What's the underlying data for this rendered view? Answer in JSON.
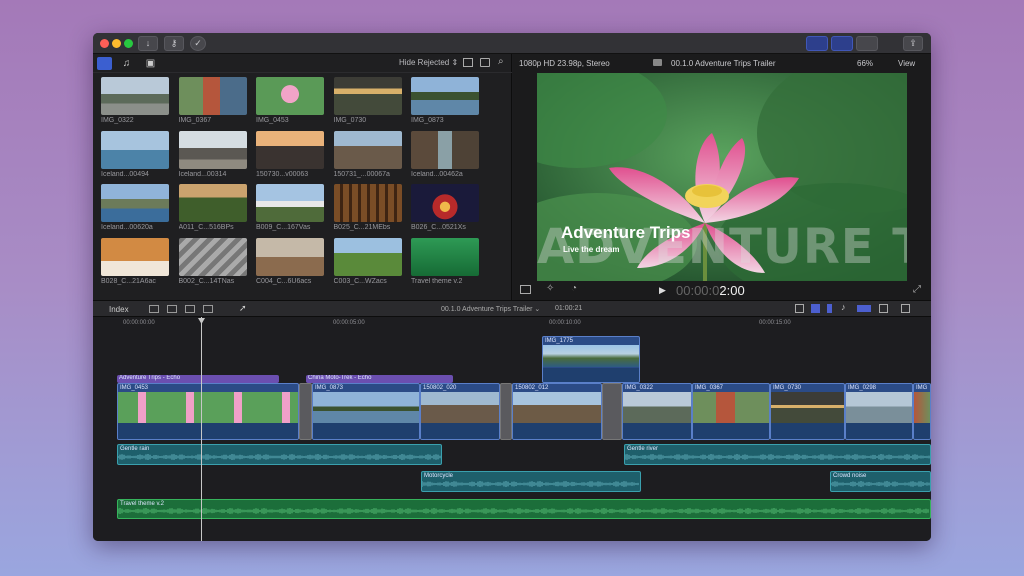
{
  "toolbar": {
    "download": "↓",
    "key": "⚷",
    "check": "✓",
    "share": "⇪"
  },
  "browser": {
    "hide_rejected": "Hide Rejected ⇕",
    "clips": [
      {
        "name": "IMG_0322",
        "theme": "city"
      },
      {
        "name": "IMG_0367",
        "theme": "person"
      },
      {
        "name": "IMG_0453",
        "theme": "lotus"
      },
      {
        "name": "IMG_0730",
        "theme": "lake"
      },
      {
        "name": "IMG_0873",
        "theme": "mountain"
      },
      {
        "name": "Iceland...00494",
        "theme": "ice"
      },
      {
        "name": "Iceland...00314",
        "theme": "beach"
      },
      {
        "name": "150730...v00063",
        "theme": "sunset"
      },
      {
        "name": "150731_...00067a",
        "theme": "rocks"
      },
      {
        "name": "Iceland...00462a",
        "theme": "canyon"
      },
      {
        "name": "Iceland...00620a",
        "theme": "coast"
      },
      {
        "name": "A011_C...516BPs",
        "theme": "hill"
      },
      {
        "name": "B009_C...167Vas",
        "theme": "alps"
      },
      {
        "name": "B025_C...21MEbs",
        "theme": "wine"
      },
      {
        "name": "B026_C...0521Xs",
        "theme": "tunnel"
      },
      {
        "name": "B028_C...21A6ac",
        "theme": "arch"
      },
      {
        "name": "B002_C...14TNas",
        "theme": "plaza"
      },
      {
        "name": "C004_C...6U6acs",
        "theme": "town"
      },
      {
        "name": "C003_C...WZacs",
        "theme": "fields"
      },
      {
        "name": "Travel theme v.2",
        "theme": "audio"
      }
    ]
  },
  "viewer": {
    "format": "1080p HD 23.98p, Stereo",
    "project": "00.1.0 Adventure Trips Trailer",
    "zoom": "66%",
    "view": "View",
    "overlay_big": "ADVENTURE TRIPS",
    "title": "Adventure Trips",
    "subtitle": "Live the dream",
    "timecode_dim": "00:00:0",
    "timecode_bright": "2:00"
  },
  "timeline": {
    "index": "Index",
    "project": "00.1.0 Adventure Trips Trailer ⌄",
    "duration": "01:00:21",
    "ruler": [
      "00:00:00:00",
      "00:00:05:00",
      "00:00:10:00",
      "00:00:15:00"
    ],
    "connected_clip": "IMG_1775",
    "titles": [
      "Adventure Trips - Echo",
      "China Moto-Trek - Echo"
    ],
    "primary": [
      "IMG_0453",
      "IMG_0873",
      "150802_020",
      "150802_012",
      "IMG_0322",
      "IMG_0367",
      "IMG_0730",
      "IMG_0298",
      "IMG"
    ],
    "audio": [
      "Gentle rain",
      "Gentle river",
      "Motorcycle",
      "Crowd noise"
    ],
    "music": "Travel theme v.2"
  },
  "colors": {
    "accent": "#2d3f8c",
    "video_clip": "#2b4b86",
    "audio_clip": "#1e5f6b",
    "music_clip": "#1c6e3a",
    "title_clip": "#6b4fb0"
  }
}
